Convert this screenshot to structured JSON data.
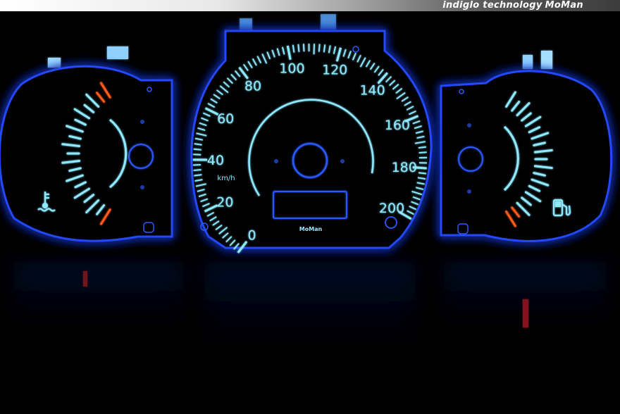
{
  "banner": {
    "tagline": "indiglo technology",
    "brand": "MoMan"
  },
  "speedometer": {
    "unit_label": "km/h",
    "brand_label": "MoMan",
    "scale_labels": [
      "0",
      "20",
      "40",
      "60",
      "80",
      "100",
      "120",
      "140",
      "160",
      "180",
      "200"
    ]
  },
  "temperature_gauge": {
    "icon": "coolant-temperature-icon"
  },
  "fuel_gauge": {
    "icon": "fuel-pump-icon"
  },
  "colors": {
    "glow": "#1a3cff",
    "marking": "#8fe9ff",
    "warning": "#ff5a1a",
    "background": "#000000"
  }
}
